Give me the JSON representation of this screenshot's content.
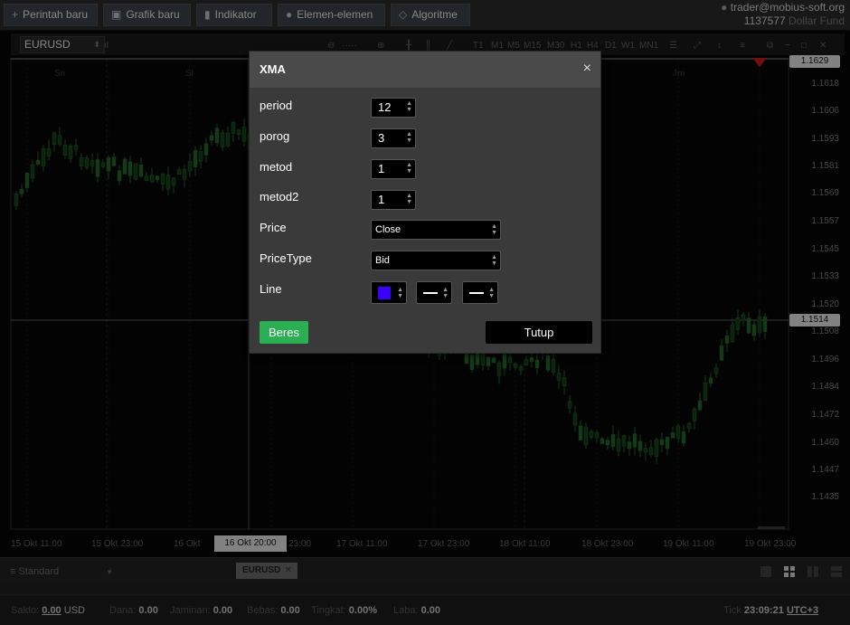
{
  "toolbar": {
    "buttons": [
      {
        "label": "Perintah baru",
        "icon": "plus-icon"
      },
      {
        "label": "Grafik baru",
        "icon": "chart-icon"
      },
      {
        "label": "Indikator",
        "icon": "bars-icon"
      },
      {
        "label": "Elemen-elemen",
        "icon": "shapes-icon"
      },
      {
        "label": "Algoritme",
        "icon": "diamond-icon"
      }
    ]
  },
  "account": {
    "user": "trader@mobius-soft.org",
    "number": "1137577",
    "fund": "Dollar Fund"
  },
  "chart": {
    "symbol": "EURUSD",
    "timeframes": [
      "T1",
      "M1",
      "M5",
      "M15",
      "M30",
      "H1",
      "H4",
      "D1",
      "W1",
      "MN1"
    ],
    "day_labels": [
      "Sn",
      "Sl",
      "Jm"
    ],
    "price_labels": [
      "1.1618",
      "1.1606",
      "1.1593",
      "1.1581",
      "1.1569",
      "1.1557",
      "1.1545",
      "1.1533",
      "1.1520",
      "1.1508",
      "1.1496",
      "1.1484",
      "1.1472",
      "1.1460",
      "1.1447",
      "1.1435"
    ],
    "top_price_badge": "1.1629",
    "current_price_badge": "1.1514",
    "time_labels": [
      "15 Okt 11:00",
      "15 Okt 23:00",
      "16 Okt",
      "16 Okt 20:00",
      "23:00",
      "17 Okt 11:00",
      "17 Okt 23:00",
      "18 Okt 11:00",
      "18 Okt 23:00",
      "19 Okt 11:00",
      "19 Okt 23:00"
    ],
    "cursor_time": "16 Okt 20:00",
    "colors": {
      "up": "#1f5a26",
      "down": "#0f3a16",
      "grid": "#151515",
      "background": "#050505"
    }
  },
  "tabbar": {
    "layout": "Standard",
    "tab": "EURUSD",
    "tab_close": "✕"
  },
  "status": {
    "saldo_label": "Saldo:",
    "saldo_value": "0.00",
    "currency": "USD",
    "dana_label": "Dana:",
    "dana_value": "0.00",
    "jaminan_label": "Jaminan:",
    "jaminan_value": "0.00",
    "bebas_label": "Bebas:",
    "bebas_value": "0.00",
    "tingkat_label": "Tingkat:",
    "tingkat_value": "0.00%",
    "laba_label": "Laba:",
    "laba_value": "0.00",
    "tick_label": "Tick",
    "time": "23:09:21",
    "tz": "UTC+3"
  },
  "dialog": {
    "title": "XMA",
    "close": "×",
    "fields": {
      "period": {
        "label": "period",
        "value": "12"
      },
      "porog": {
        "label": "porog",
        "value": "3"
      },
      "metod": {
        "label": "metod",
        "value": "1"
      },
      "metod2": {
        "label": "metod2",
        "value": "1"
      },
      "price": {
        "label": "Price",
        "value": "Close"
      },
      "pricetype": {
        "label": "PriceType",
        "value": "Bid"
      },
      "line": {
        "label": "Line",
        "color": "#3b00ff",
        "width": "—",
        "style": "—"
      }
    },
    "ok_button": "Beres",
    "close_button": "Tutup",
    "ok_color": "#2ab052"
  }
}
